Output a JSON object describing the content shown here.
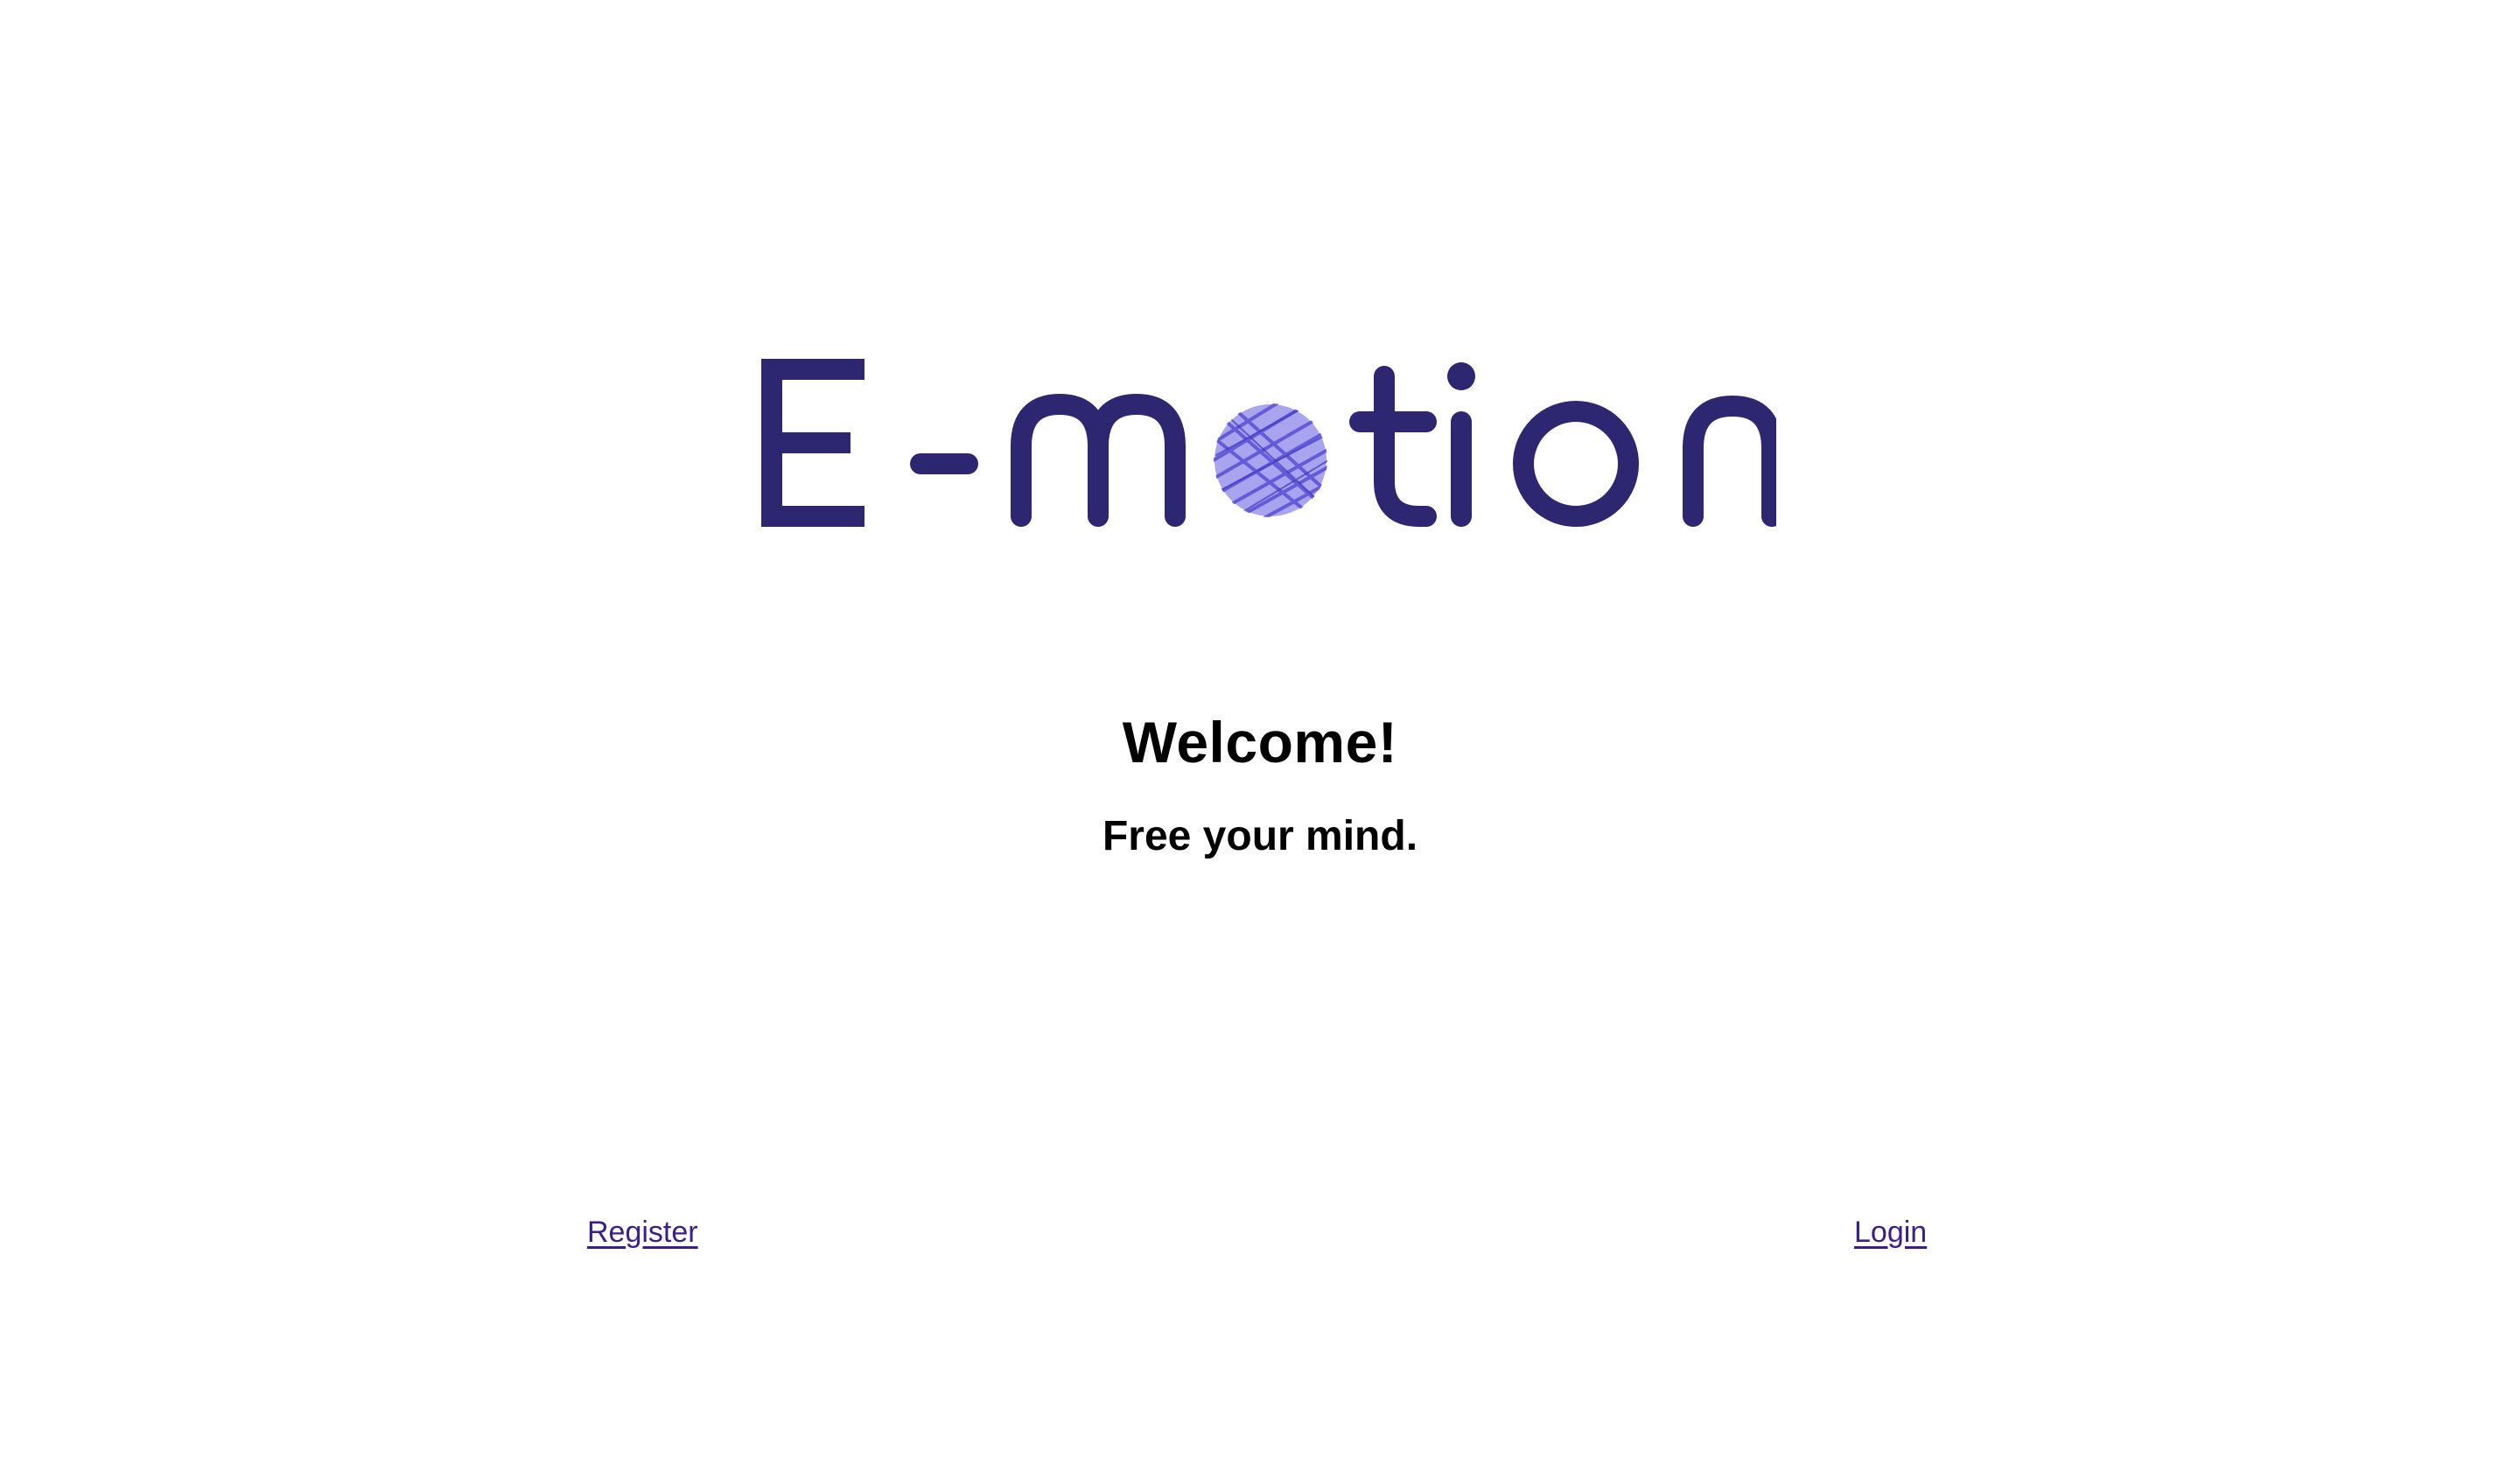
{
  "app": {
    "logo_text": "E-motion",
    "logo_color": "#2d2670",
    "logo_accent_color": "#6b63d8"
  },
  "main": {
    "welcome": "Welcome!",
    "tagline": "Free your mind."
  },
  "nav": {
    "register_label": "Register",
    "login_label": "Login",
    "link_color": "#3b1e87"
  },
  "icons": {
    "logo_o": "scribble-circle-icon"
  }
}
